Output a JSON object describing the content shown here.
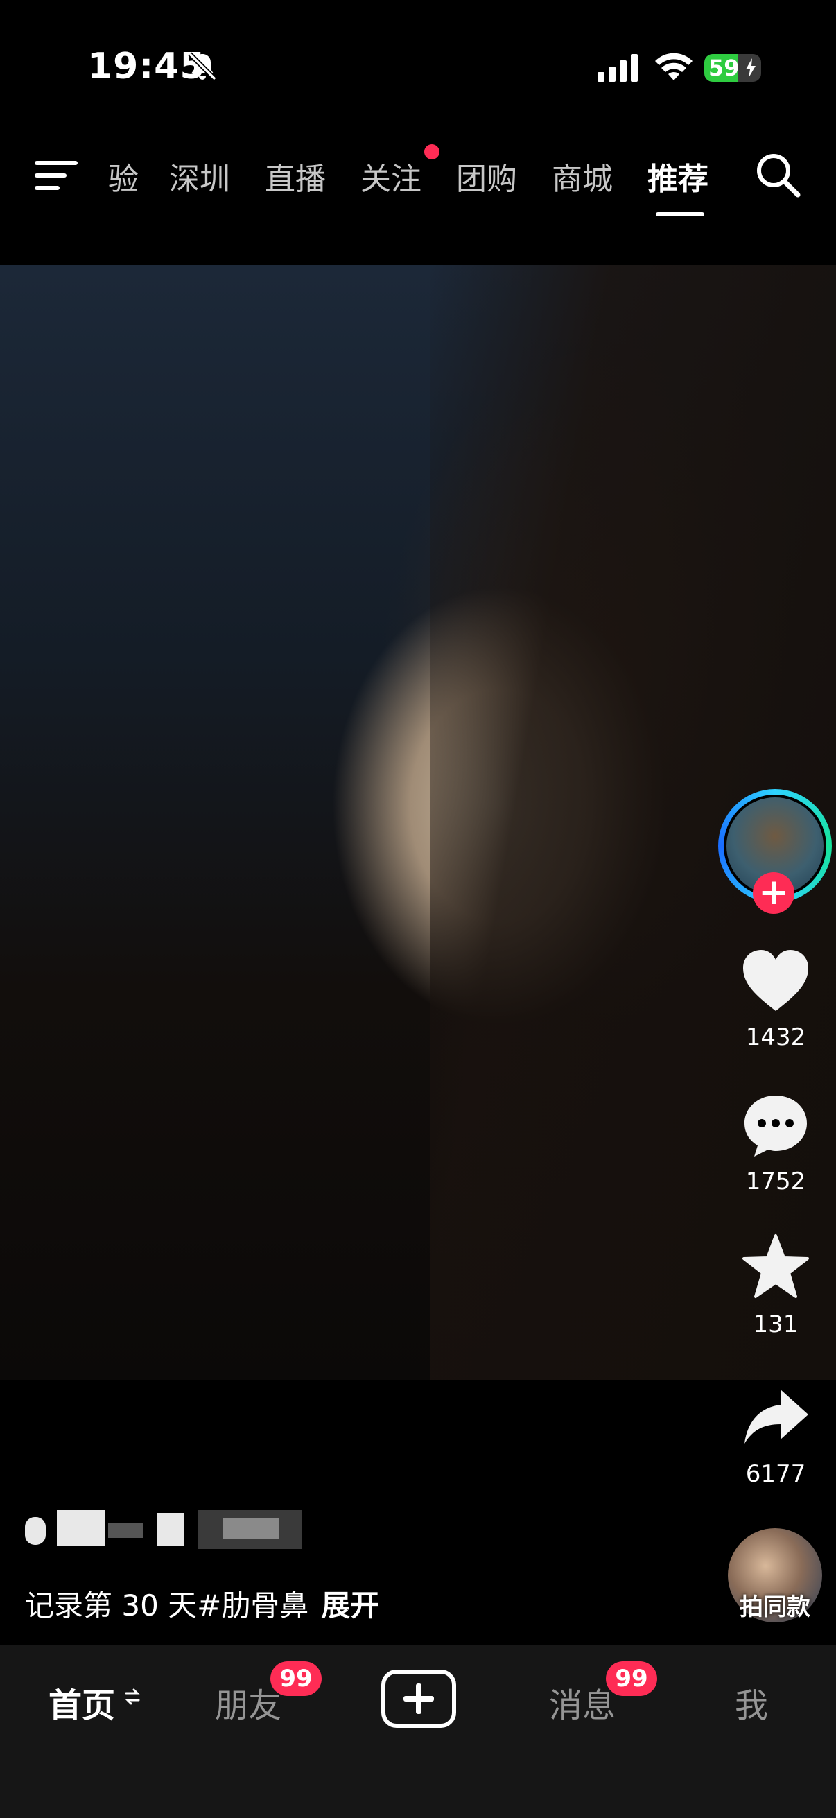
{
  "status_bar": {
    "time": "19:45",
    "battery": "59",
    "battery_level": 0.59,
    "icons": [
      "bell-muted-icon",
      "signal-icon",
      "wifi-icon",
      "battery-charging-icon"
    ]
  },
  "top_nav": {
    "tabs": [
      {
        "label": "验"
      },
      {
        "label": "深圳"
      },
      {
        "label": "直播"
      },
      {
        "label": "关注"
      },
      {
        "label": "团购"
      },
      {
        "label": "商城"
      },
      {
        "label": "推荐"
      }
    ],
    "active_tab": "推荐",
    "icons": [
      "menu-icon",
      "search-icon"
    ]
  },
  "right_rail": {
    "likes": "1432",
    "comments": "1752",
    "favorites": "131",
    "shares": "6177",
    "remix_label": "拍同款"
  },
  "caption": {
    "text": "记录第 30 天#肋骨鼻",
    "expand": "展开"
  },
  "bottom_nav": {
    "home": "首页",
    "friends": "朋友",
    "friends_badge": "99",
    "messages": "消息",
    "messages_badge": "99",
    "me": "我"
  },
  "colors": {
    "accent": "#fe2c55",
    "background": "#000000",
    "bottom_bar": "#161616"
  }
}
